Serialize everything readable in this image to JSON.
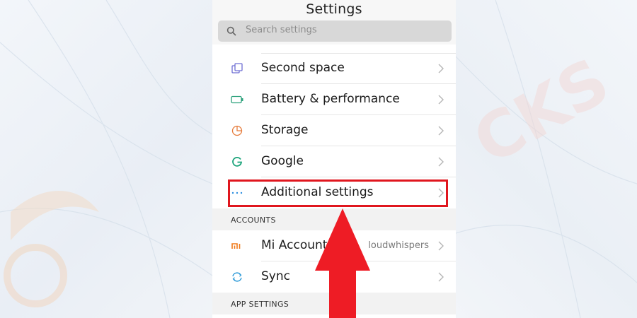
{
  "header": {
    "title": "Settings"
  },
  "search": {
    "placeholder": "Search settings"
  },
  "items": [
    {
      "label": "Second space",
      "icon": "second-space-icon",
      "color": "#6f6fd4"
    },
    {
      "label": "Battery & performance",
      "icon": "battery-icon",
      "color": "#2aa07a"
    },
    {
      "label": "Storage",
      "icon": "storage-icon",
      "color": "#e67c3c"
    },
    {
      "label": "Google",
      "icon": "google-icon",
      "color": "#1aa37a"
    },
    {
      "label": "Additional settings",
      "icon": "more-dots-icon",
      "color": "#2d8fe0"
    }
  ],
  "sections": {
    "accounts": "ACCOUNTS",
    "app_settings": "APP SETTINGS"
  },
  "accounts": [
    {
      "label": "Mi Account",
      "value": "loudwhispers",
      "icon": "mi-logo-icon",
      "color": "#f07a1a"
    },
    {
      "label": "Sync",
      "icon": "sync-icon",
      "color": "#2d9ad8"
    }
  ],
  "annotation": {
    "highlight_color": "#e0161e",
    "highlighted_item": "Additional settings"
  }
}
